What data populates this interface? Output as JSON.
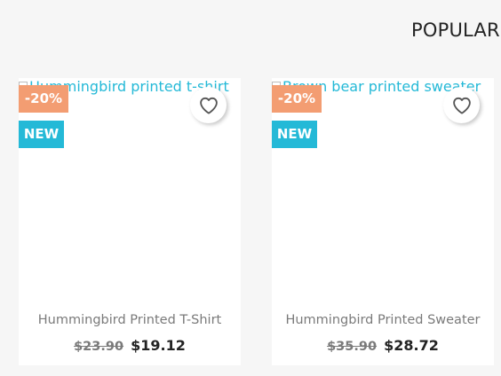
{
  "section": {
    "title": "POPULAR"
  },
  "products": [
    {
      "image_alt": "Hummingbird printed t-shirt",
      "discount_badge": "-20%",
      "new_badge": "NEW",
      "name": "Hummingbird Printed T-Shirt",
      "regular_price": "$23.90",
      "price": "$19.12"
    },
    {
      "image_alt": "Brown bear printed sweater",
      "discount_badge": "-20%",
      "new_badge": "NEW",
      "name": "Hummingbird Printed Sweater",
      "regular_price": "$35.90",
      "price": "$28.72"
    }
  ],
  "icons": {
    "wishlist": "heart-outline-icon",
    "broken_image": "broken-image-icon"
  },
  "colors": {
    "background": "#f6f6f6",
    "card": "#ffffff",
    "discount_badge": "#f39d72",
    "new_badge": "#24b9d7",
    "link": "#24b9d7",
    "text_dark": "#232323",
    "text_muted": "#7a7a7a"
  }
}
